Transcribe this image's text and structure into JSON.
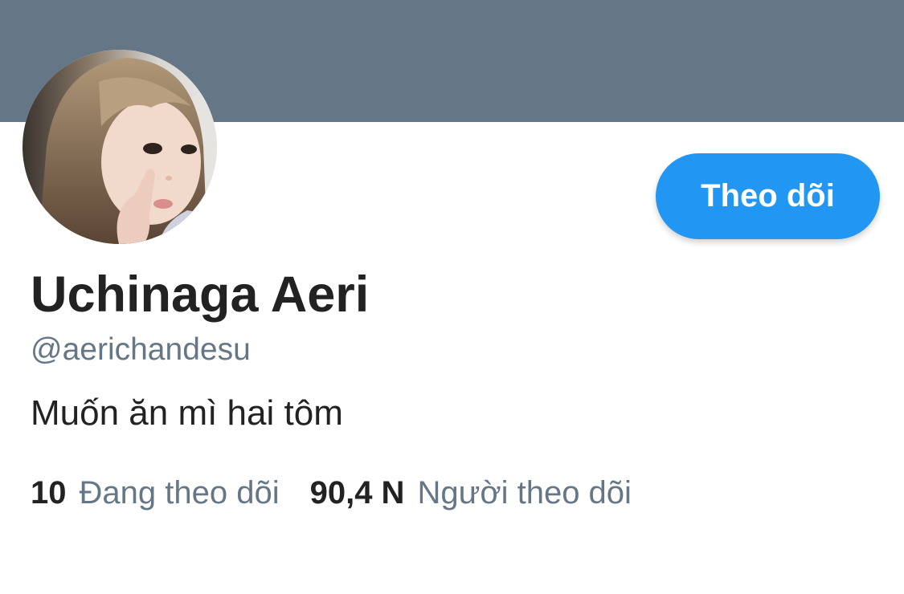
{
  "profile": {
    "display_name": "Uchinaga Aeri",
    "handle": "@aerichandesu",
    "bio": "Muốn ăn mì hai tôm",
    "follow_button_label": "Theo dõi",
    "avatar": "profile-photo"
  },
  "stats": {
    "following_count": "10",
    "following_label": "Đang theo dõi",
    "followers_count": "90,4 N",
    "followers_label": "Người theo dõi"
  },
  "colors": {
    "banner": "#657786",
    "accent": "#2197F3",
    "text_primary": "#222222",
    "text_secondary": "#657786"
  }
}
